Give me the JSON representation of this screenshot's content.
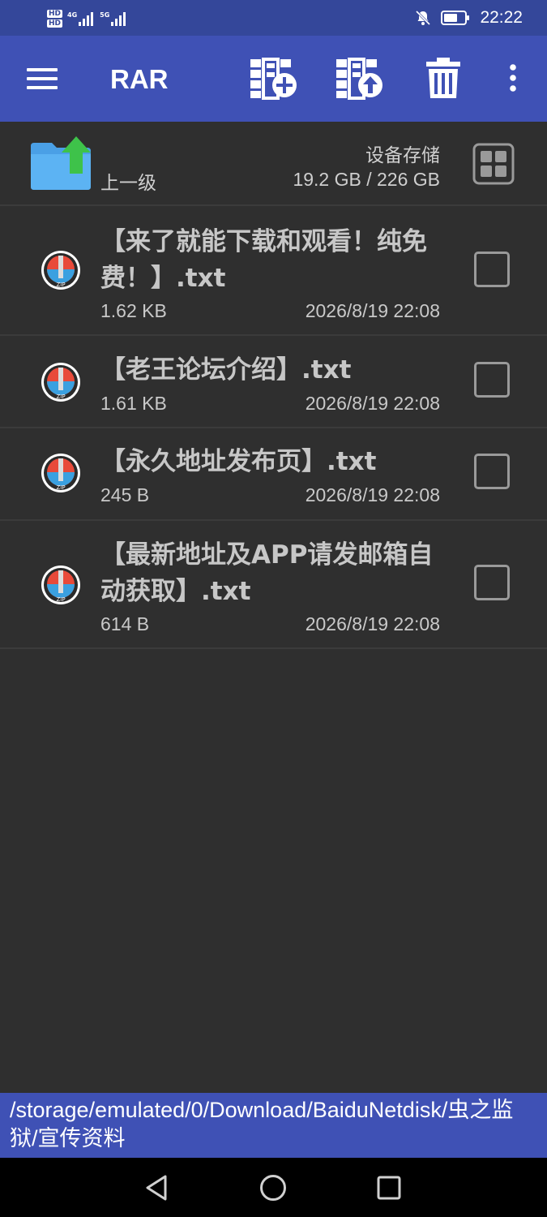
{
  "status_bar": {
    "hd1": "HD",
    "hd2": "HD",
    "net1": "4G",
    "net2": "5G",
    "time": "22:22",
    "icons": [
      "notifications-off-icon",
      "battery-icon"
    ]
  },
  "app_bar": {
    "title": "RAR",
    "actions": [
      "add-archive-icon",
      "extract-archive-icon",
      "delete-icon",
      "more-options-icon"
    ]
  },
  "parent": {
    "label": "上一级",
    "storage_name": "设备存储",
    "storage_size": "19.2 GB / 226 GB"
  },
  "files": [
    {
      "name": "【来了就能下载和观看！纯免费！】.txt",
      "size": "1.62 KB",
      "date": "2026/8/19 22:08",
      "checked": false
    },
    {
      "name": "【老王论坛介绍】.txt",
      "size": "1.61 KB",
      "date": "2026/8/19 22:08",
      "checked": false
    },
    {
      "name": "【永久地址发布页】.txt",
      "size": "245 B",
      "date": "2026/8/19 22:08",
      "checked": false
    },
    {
      "name": "【最新地址及APP请发邮箱自动获取】.txt",
      "size": "614 B",
      "date": "2026/8/19 22:08",
      "checked": false
    }
  ],
  "path": "/storage/emulated/0/Download/BaiduNetdisk/虫之监狱/宣传资料",
  "colors": {
    "status_bar": "#34479a",
    "app_bar": "#3f51b5",
    "background": "#2f2f2f",
    "nav_bar": "#000000"
  }
}
